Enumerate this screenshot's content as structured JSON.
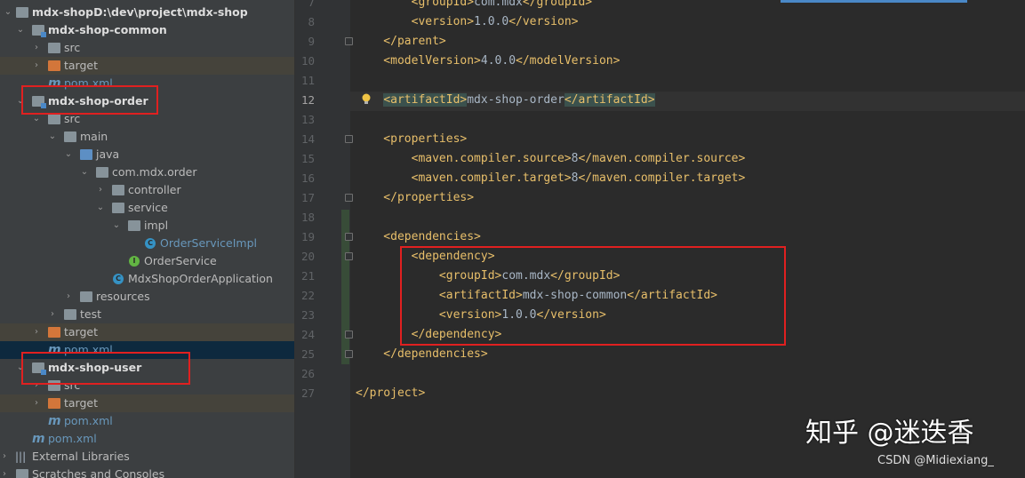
{
  "project_tree": {
    "root": {
      "label": "mdx-shop",
      "path": "D:\\dev\\project\\mdx-shop"
    },
    "rows": [
      {
        "label": "mdx-shop-common"
      },
      {
        "label": "src"
      },
      {
        "label": "target"
      },
      {
        "label": "pom.xml"
      },
      {
        "label": "mdx-shop-order"
      },
      {
        "label": "src"
      },
      {
        "label": "main"
      },
      {
        "label": "java"
      },
      {
        "label": "com.mdx.order"
      },
      {
        "label": "controller"
      },
      {
        "label": "service"
      },
      {
        "label": "impl"
      },
      {
        "label": "OrderServiceImpl"
      },
      {
        "label": "OrderService"
      },
      {
        "label": "MdxShopOrderApplication"
      },
      {
        "label": "resources"
      },
      {
        "label": "test"
      },
      {
        "label": "target"
      },
      {
        "label": "pom.xml"
      },
      {
        "label": "mdx-shop-user"
      },
      {
        "label": "src"
      },
      {
        "label": "target"
      },
      {
        "label": "pom.xml"
      },
      {
        "label": "pom.xml"
      },
      {
        "label": "External Libraries"
      },
      {
        "label": "Scratches and Consoles"
      }
    ]
  },
  "editor": {
    "current_line": "12",
    "lines": [
      {
        "num": "7",
        "parts": [
          [
            "t",
            "        <groupId>"
          ],
          [
            "x",
            "com.mdx"
          ],
          [
            "t",
            "</groupId>"
          ]
        ]
      },
      {
        "num": "8",
        "parts": [
          [
            "t",
            "        <version>"
          ],
          [
            "x",
            "1.0.0"
          ],
          [
            "t",
            "</version>"
          ]
        ]
      },
      {
        "num": "9",
        "parts": [
          [
            "t",
            "    </parent>"
          ]
        ]
      },
      {
        "num": "10",
        "parts": [
          [
            "t",
            "    <modelVersion>"
          ],
          [
            "x",
            "4.0.0"
          ],
          [
            "t",
            "</modelVersion>"
          ]
        ]
      },
      {
        "num": "11",
        "parts": []
      },
      {
        "num": "12",
        "parts": [
          [
            "x",
            "    "
          ],
          [
            "h",
            "<artifactId>"
          ],
          [
            "x",
            "mdx-shop-order"
          ],
          [
            "h",
            "</artifactId>"
          ]
        ]
      },
      {
        "num": "13",
        "parts": []
      },
      {
        "num": "14",
        "parts": [
          [
            "t",
            "    <properties>"
          ]
        ]
      },
      {
        "num": "15",
        "parts": [
          [
            "t",
            "        <maven.compiler.source>"
          ],
          [
            "x",
            "8"
          ],
          [
            "t",
            "</maven.compiler.source>"
          ]
        ]
      },
      {
        "num": "16",
        "parts": [
          [
            "t",
            "        <maven.compiler.target>"
          ],
          [
            "x",
            "8"
          ],
          [
            "t",
            "</maven.compiler.target>"
          ]
        ]
      },
      {
        "num": "17",
        "parts": [
          [
            "t",
            "    </properties>"
          ]
        ]
      },
      {
        "num": "18",
        "parts": []
      },
      {
        "num": "19",
        "parts": [
          [
            "t",
            "    <dependencies>"
          ]
        ]
      },
      {
        "num": "20",
        "parts": [
          [
            "t",
            "        <dependency>"
          ]
        ]
      },
      {
        "num": "21",
        "parts": [
          [
            "t",
            "            <groupId>"
          ],
          [
            "x",
            "com.mdx"
          ],
          [
            "t",
            "</groupId>"
          ]
        ]
      },
      {
        "num": "22",
        "parts": [
          [
            "t",
            "            <artifactId>"
          ],
          [
            "x",
            "mdx-shop-common"
          ],
          [
            "t",
            "</artifactId>"
          ]
        ]
      },
      {
        "num": "23",
        "parts": [
          [
            "t",
            "            <version>"
          ],
          [
            "x",
            "1.0.0"
          ],
          [
            "t",
            "</version>"
          ]
        ]
      },
      {
        "num": "24",
        "parts": [
          [
            "t",
            "        </dependency>"
          ]
        ]
      },
      {
        "num": "25",
        "parts": [
          [
            "t",
            "    </dependencies>"
          ]
        ]
      },
      {
        "num": "26",
        "parts": []
      },
      {
        "num": "27",
        "parts": [
          [
            "t",
            "</project>"
          ]
        ]
      }
    ]
  },
  "watermark": {
    "main": "知乎 @迷迭香",
    "sub": "CSDN @Midiexiang_"
  },
  "colors": {
    "annotation_box": "#e02020",
    "xml_tag": "#e8bf6a",
    "xml_text": "#a9b7c6"
  }
}
